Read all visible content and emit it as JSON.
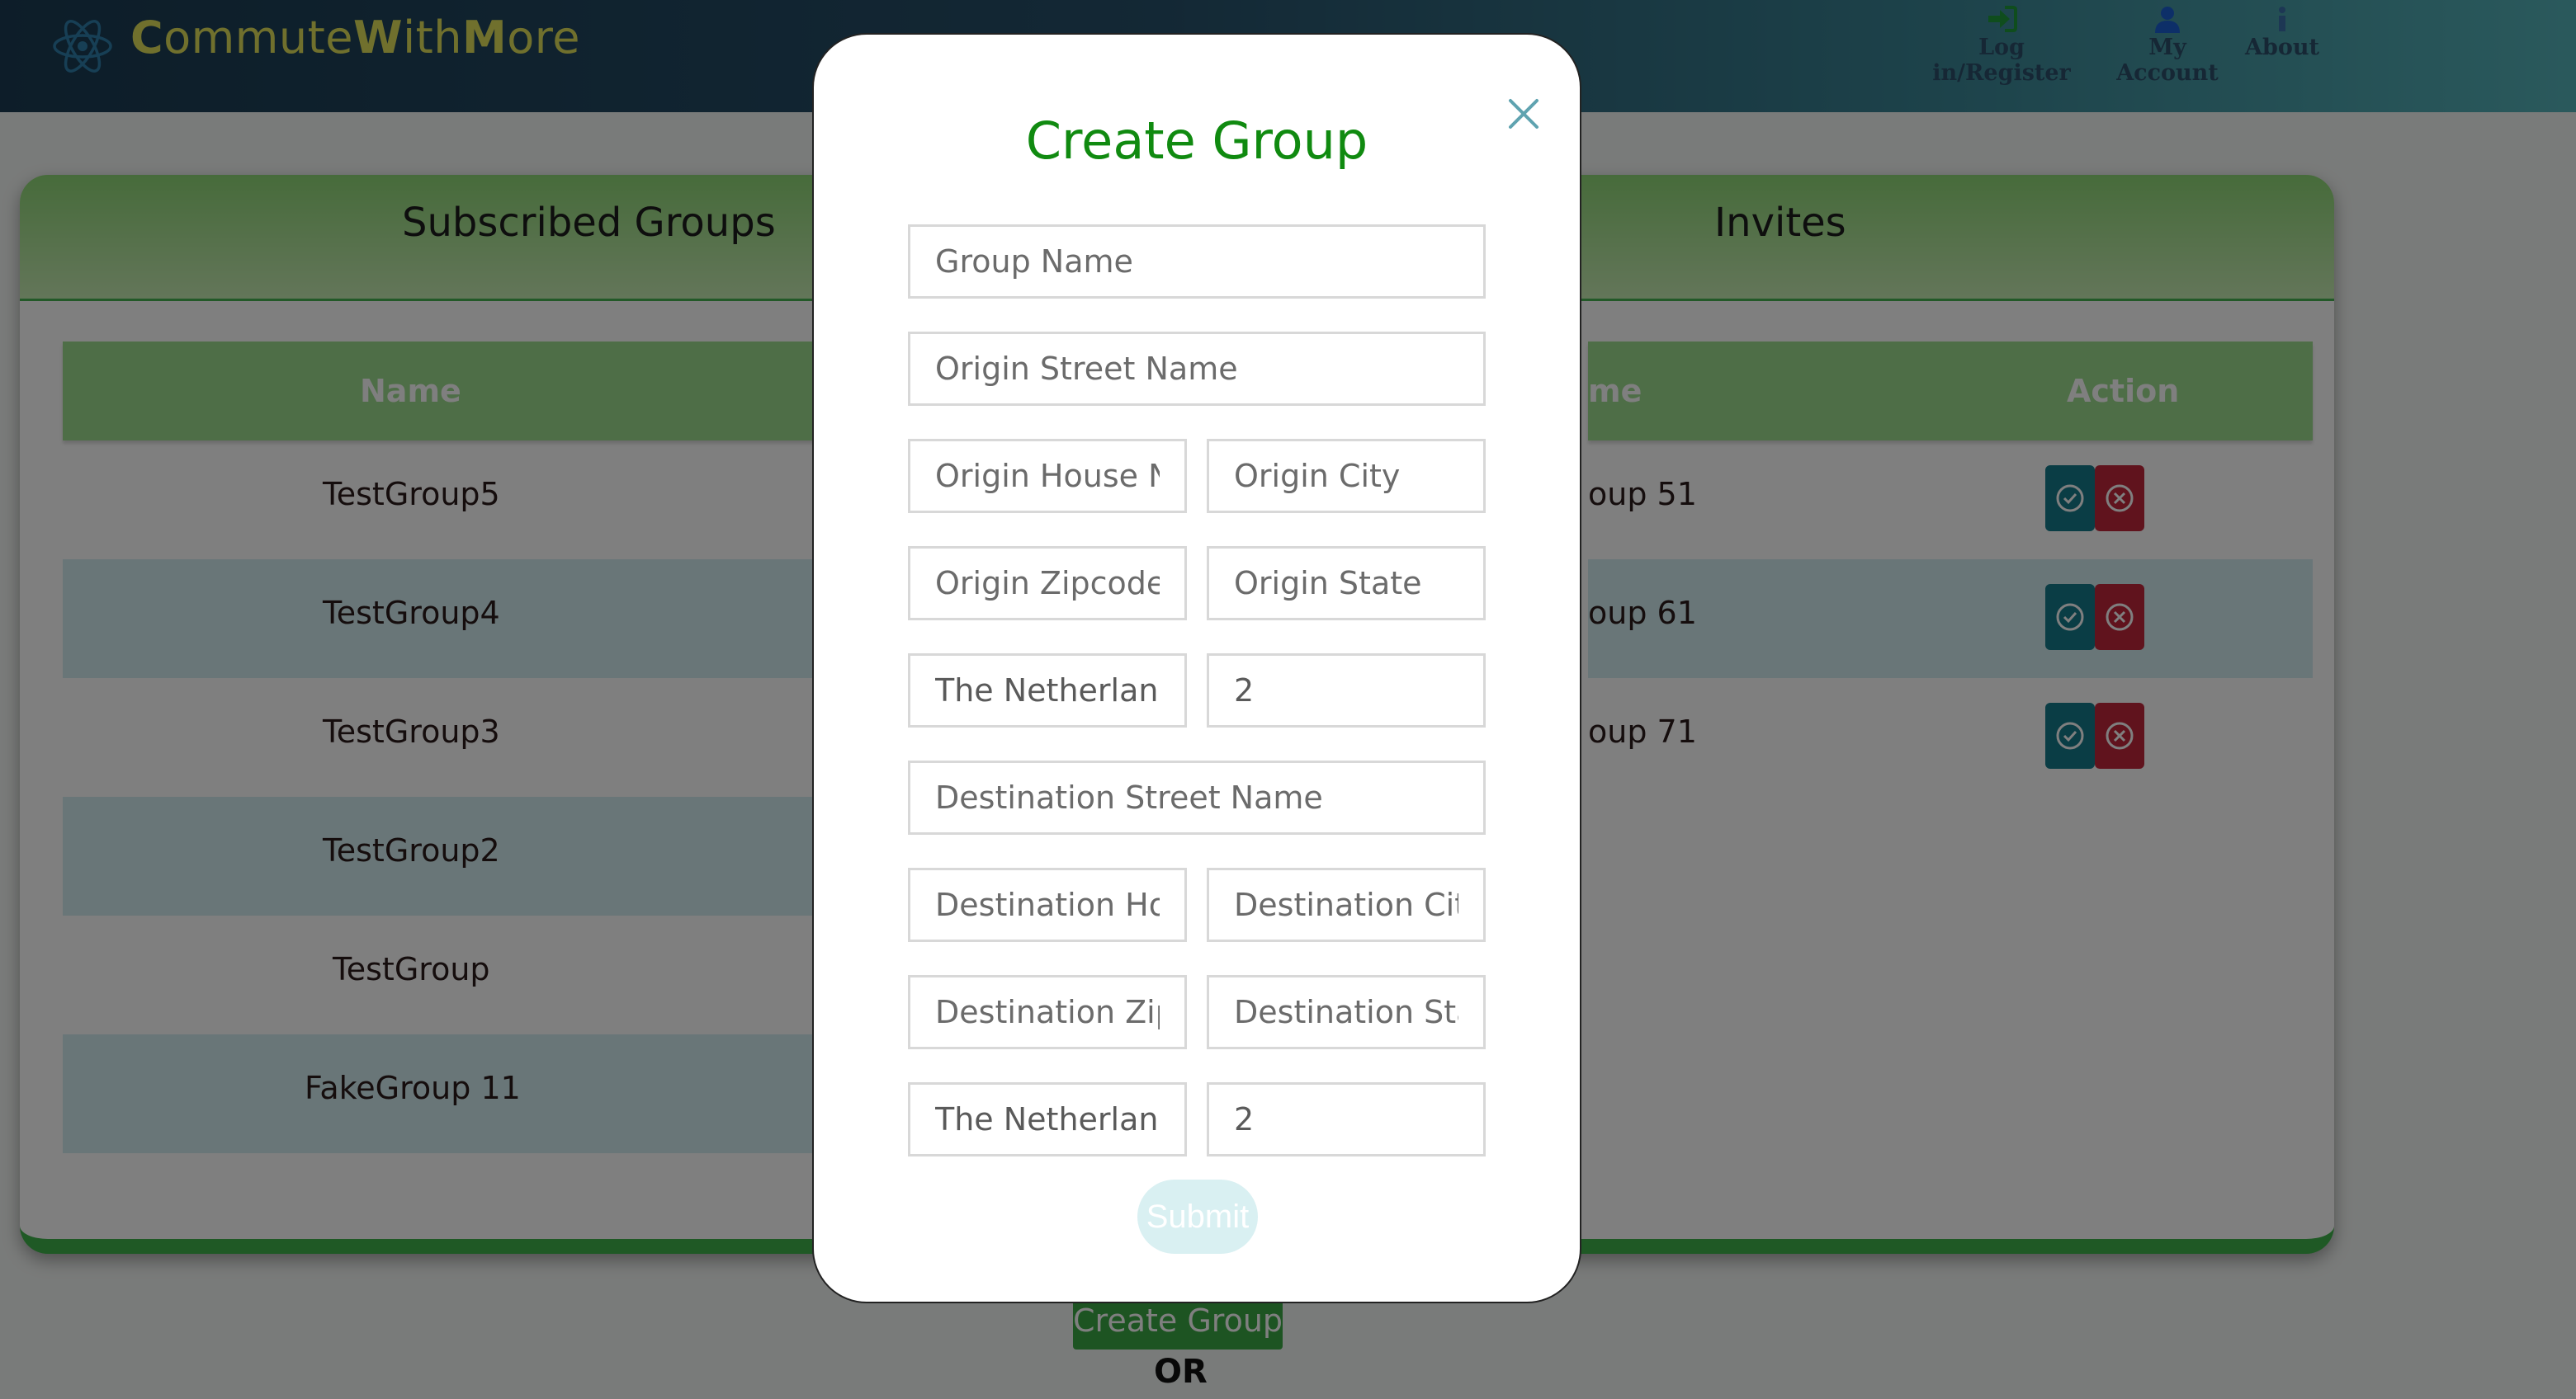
{
  "header": {
    "brand": {
      "c1": "C",
      "p1": "ommute",
      "c2": "W",
      "p2": "ith",
      "c3": "M",
      "p3": "ore"
    },
    "nav": [
      {
        "label": "Log in/Register",
        "icon": "sign-in-icon"
      },
      {
        "label": "My Account",
        "icon": "user-icon"
      },
      {
        "label": "About",
        "icon": "info-icon"
      }
    ]
  },
  "subscribed": {
    "title": "Subscribed Groups",
    "column_name": "Name",
    "rows": [
      "TestGroup5",
      "TestGroup4",
      "TestGroup3",
      "TestGroup2",
      "TestGroup",
      "FakeGroup 11"
    ]
  },
  "invites": {
    "title": "Invites",
    "column_name_partial": "me",
    "column_action": "Action",
    "rows": [
      "oup 51",
      "oup 61",
      "oup 71"
    ]
  },
  "below_panel": {
    "create_group_button": "Create Group",
    "or_text": "OR"
  },
  "modal": {
    "title": "Create Group",
    "fields": {
      "group_name": {
        "placeholder": "Group Name",
        "value": ""
      },
      "origin_street": {
        "placeholder": "Origin Street Name",
        "value": ""
      },
      "origin_house": {
        "placeholder": "Origin House N",
        "value": ""
      },
      "origin_city": {
        "placeholder": "Origin City",
        "value": ""
      },
      "origin_zip": {
        "placeholder": "Origin Zipcode",
        "value": ""
      },
      "origin_state": {
        "placeholder": "Origin State",
        "value": ""
      },
      "origin_country": {
        "value": "The Netherland"
      },
      "origin_number": {
        "value": "2"
      },
      "dest_street": {
        "placeholder": "Destination Street Name",
        "value": ""
      },
      "dest_house": {
        "placeholder": "Destination Hou",
        "value": ""
      },
      "dest_city": {
        "placeholder": "Destination City",
        "value": ""
      },
      "dest_zip": {
        "placeholder": "Destination Zip",
        "value": ""
      },
      "dest_state": {
        "placeholder": "Destination Stat",
        "value": ""
      },
      "dest_country": {
        "value": "The Netherland"
      },
      "dest_number": {
        "value": "2"
      }
    },
    "submit_label": "Submit"
  },
  "colors": {
    "header_start": "#1a3b52",
    "header_end": "#55b3b9",
    "brand": "#e0e05a",
    "modal_title": "#108a10",
    "table_head": "#9ddc8f",
    "accept": "#157a8a",
    "reject": "#c0263a"
  }
}
